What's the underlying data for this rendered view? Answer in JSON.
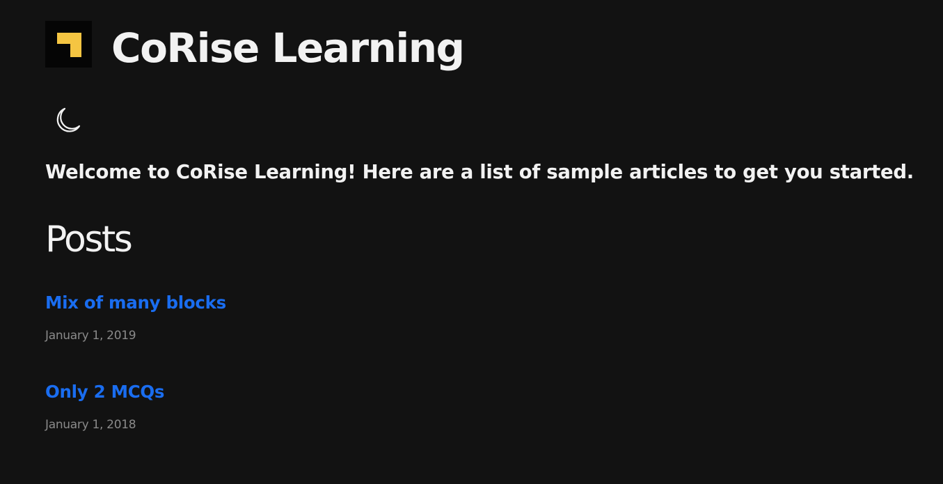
{
  "header": {
    "site_title": "CoRise Learning",
    "logo_icon": "corise-logo-icon",
    "logo_colors": {
      "background": "#050505",
      "mark": "#f5c542"
    }
  },
  "theme_toggle": {
    "icon": "moon-icon"
  },
  "intro": {
    "text": "Welcome to CoRise Learning! Here are a list of sample articles to get you started."
  },
  "posts_section": {
    "heading": "Posts",
    "items": [
      {
        "title": "Mix of many blocks",
        "date": "January 1, 2019"
      },
      {
        "title": "Only 2 MCQs",
        "date": "January 1, 2018"
      }
    ]
  },
  "colors": {
    "background": "#121212",
    "text": "#f2f2f2",
    "link": "#1a6df0",
    "muted": "#8a8a8a"
  }
}
